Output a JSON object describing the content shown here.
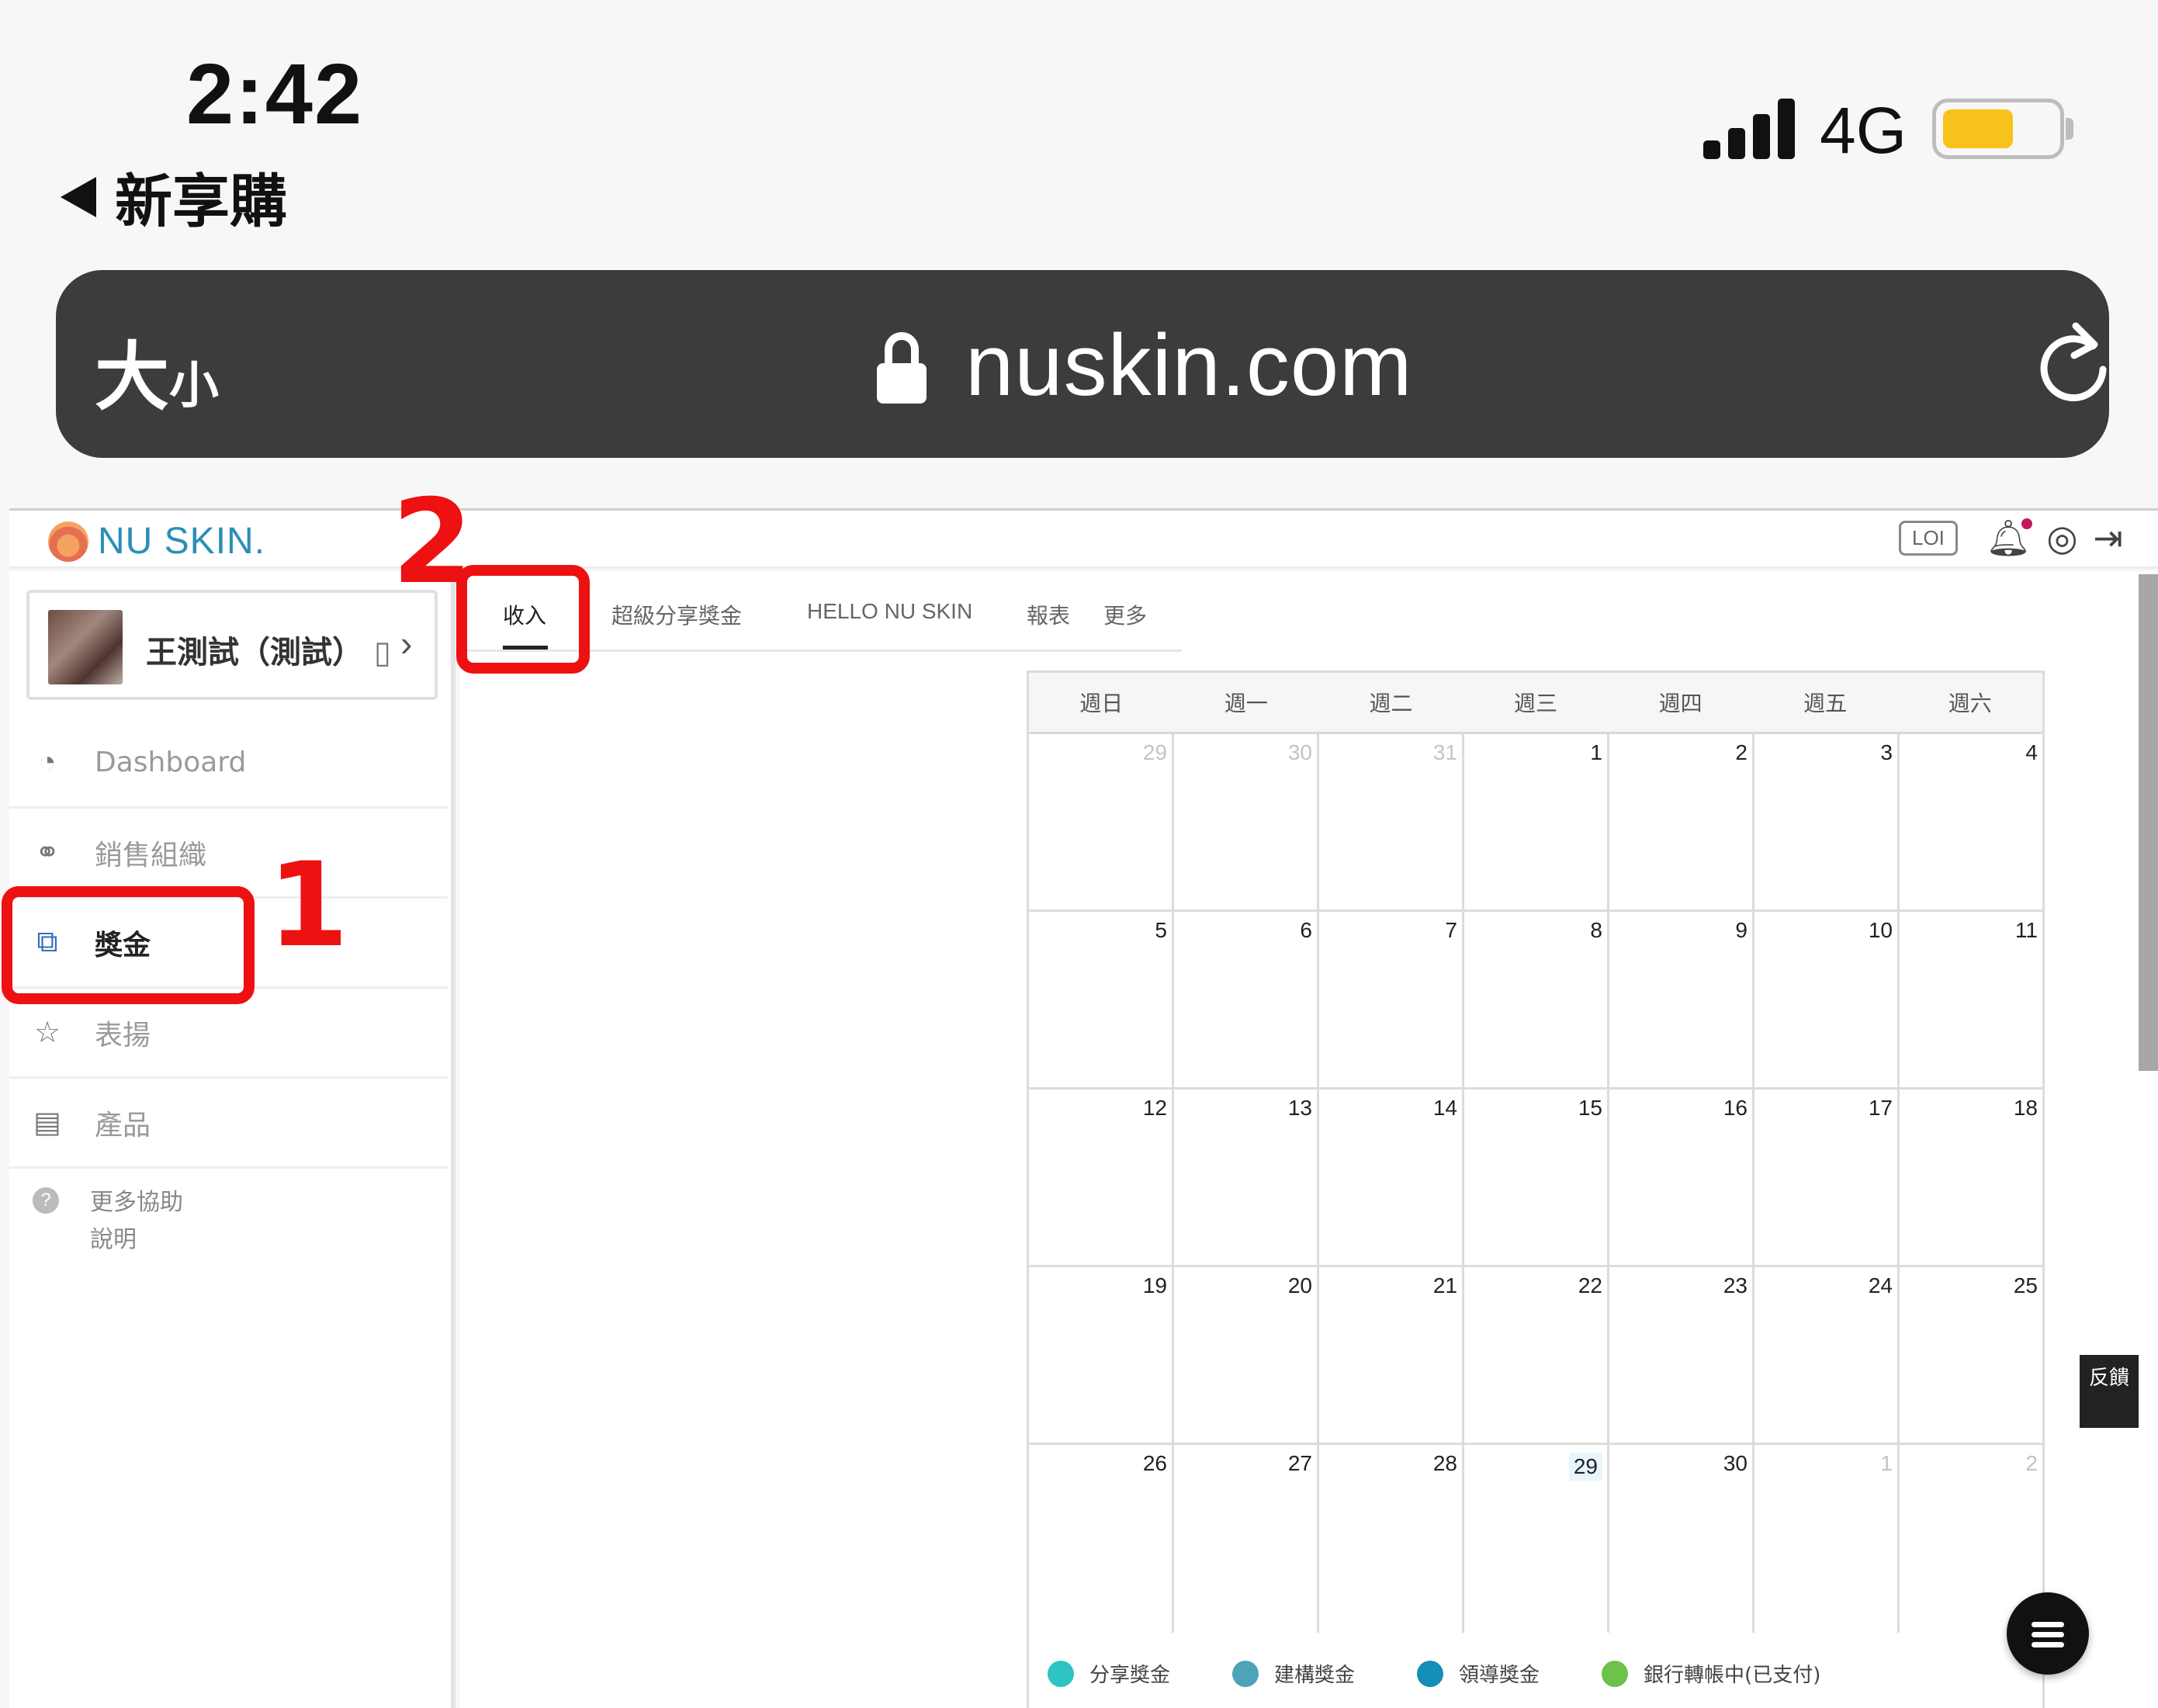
{
  "status_bar": {
    "time": "2:42",
    "back_label": "新享購",
    "network": "4G",
    "battery_level": 0.6,
    "battery_color": "#f7c21b"
  },
  "browser": {
    "text_size_big": "大",
    "text_size_small": "小",
    "url": "nuskin.com",
    "lock_icon": "lock-icon",
    "reload_icon": "reload-icon"
  },
  "app": {
    "logo_text": "NU SKIN.",
    "loi_badge": "LOI",
    "user": {
      "name": "王測試（測試）",
      "extra": "▯"
    },
    "nav": [
      {
        "label": "Dashboard",
        "icon": "◔"
      },
      {
        "label": "銷售組織",
        "icon": "⚭"
      },
      {
        "label": "獎金",
        "icon": "⧉"
      },
      {
        "label": "表揚",
        "icon": "☆"
      },
      {
        "label": "產品",
        "icon": "▤"
      }
    ],
    "help": {
      "icon": "?",
      "line1": "更多協助",
      "line2": "說明"
    },
    "tabs": [
      "收入",
      "超級分享獎金",
      "HELLO NU SKIN",
      "報表",
      "更多"
    ],
    "feedback_label": "反饋",
    "accent_color": "#2b8fb5"
  },
  "calendar": {
    "weekdays": [
      "週日",
      "週一",
      "週二",
      "週三",
      "週四",
      "週五",
      "週六"
    ],
    "weeks": [
      [
        "29",
        "30",
        "31",
        "1",
        "2",
        "3",
        "4"
      ],
      [
        "5",
        "6",
        "7",
        "8",
        "9",
        "10",
        "11"
      ],
      [
        "12",
        "13",
        "14",
        "15",
        "16",
        "17",
        "18"
      ],
      [
        "19",
        "20",
        "21",
        "22",
        "23",
        "24",
        "25"
      ],
      [
        "26",
        "27",
        "28",
        "29",
        "30",
        "1",
        "2"
      ]
    ],
    "today": "29"
  },
  "legend": [
    {
      "label": "分享獎金",
      "color": "#2ec4c4"
    },
    {
      "label": "建構獎金",
      "color": "#4fa3b8"
    },
    {
      "label": "領導獎金",
      "color": "#1390b5"
    },
    {
      "label": "銀行轉帳中(已支付)",
      "color": "#6cc24a"
    }
  ],
  "annotations": [
    "1",
    "2"
  ],
  "annotation_color": "#ee1111"
}
